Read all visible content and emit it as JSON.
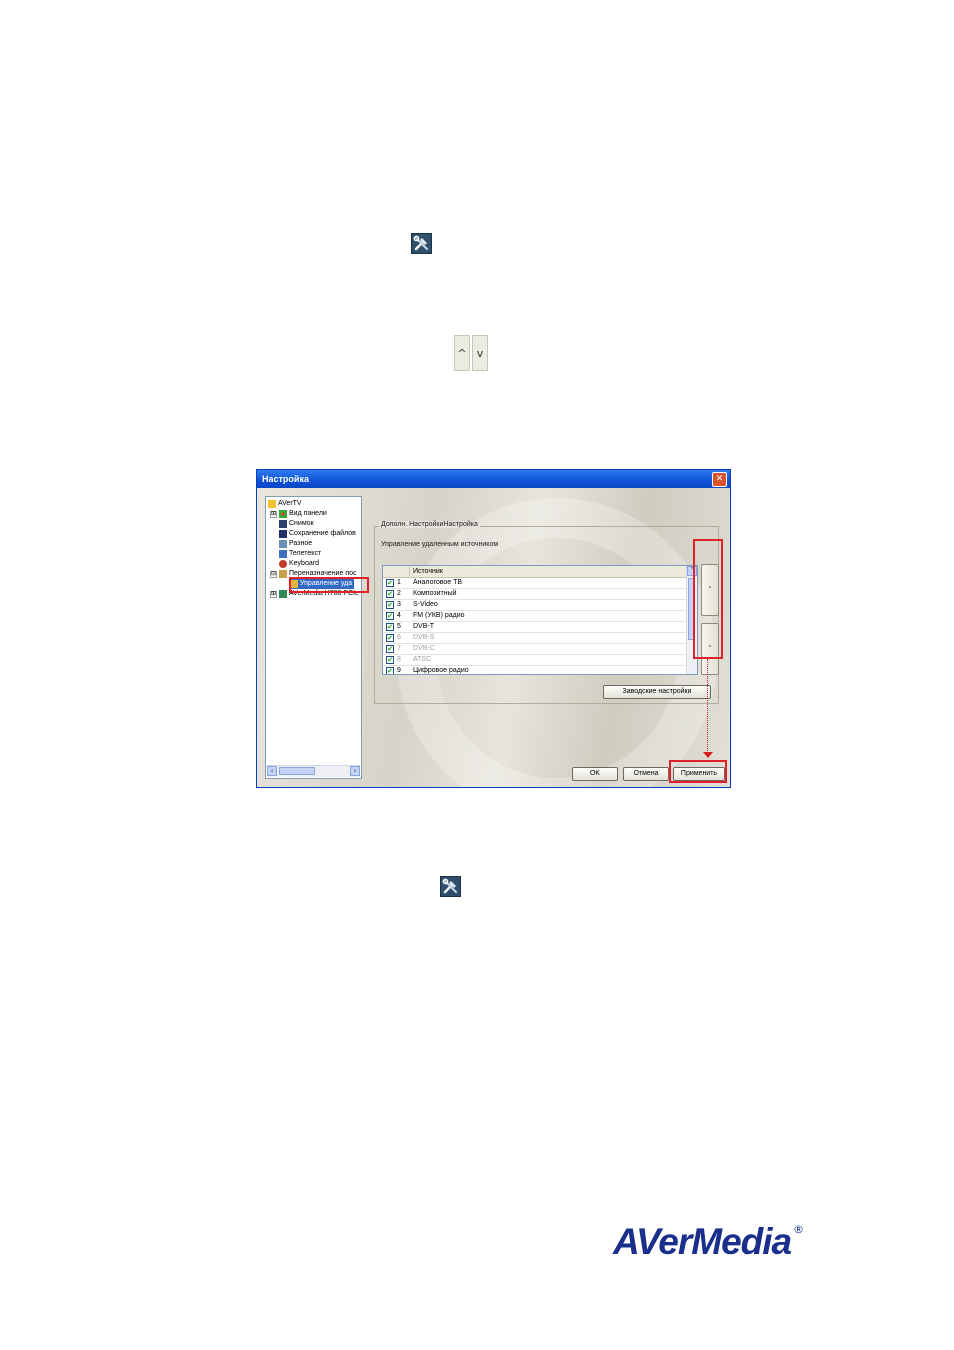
{
  "dialog": {
    "title": "Настройка",
    "close_glyph": "✕",
    "tree": {
      "items": [
        {
          "label": "AVerTV",
          "icon": "folder-icon"
        },
        {
          "label": "Вид панели",
          "icon": "panel-view-icon"
        },
        {
          "label": "Снимок",
          "icon": "snapshot-icon"
        },
        {
          "label": "Сохранение файлов",
          "icon": "save-icon"
        },
        {
          "label": "Разное",
          "icon": "misc-icon"
        },
        {
          "label": "Телетекст",
          "icon": "teletext-icon"
        },
        {
          "label": "Keyboard",
          "icon": "keyboard-icon"
        },
        {
          "label": "Переназначение пос",
          "icon": "remap-icon"
        },
        {
          "label": "Управление уда",
          "icon": "remote-control-icon"
        },
        {
          "label": "AVerMedia H788 PCIe",
          "icon": "card-icon"
        }
      ],
      "expanders": [
        "⊞",
        "⊟"
      ]
    },
    "group_label": "Дополн. НастройкиНастройка",
    "section_title": "Управление удаленным источником",
    "list": {
      "header": "Источник",
      "rows": [
        {
          "num": "1",
          "source": "Аналоговое ТВ"
        },
        {
          "num": "2",
          "source": "Композитный"
        },
        {
          "num": "3",
          "source": "S-Video"
        },
        {
          "num": "4",
          "source": "FM (УКВ) радио"
        },
        {
          "num": "5",
          "source": "DVB-T"
        },
        {
          "num": "6",
          "source": "DVB-S"
        },
        {
          "num": "7",
          "source": "DVB-C"
        },
        {
          "num": "8",
          "source": "ATSC"
        },
        {
          "num": "9",
          "source": "Цифровое радио"
        }
      ],
      "check_glyph": "✔"
    },
    "move_up_glyph": "˄",
    "move_down_glyph": "˅",
    "defaults_button": "Заводские настройки",
    "ok_button": "OK",
    "cancel_button": "Отмена",
    "apply_button": "Применить"
  },
  "icons": {
    "up_arrow": "^",
    "down_arrow": "v"
  },
  "branding": {
    "logo": "AVerMedia",
    "registered": "®",
    "color": "#1a2f8c"
  }
}
